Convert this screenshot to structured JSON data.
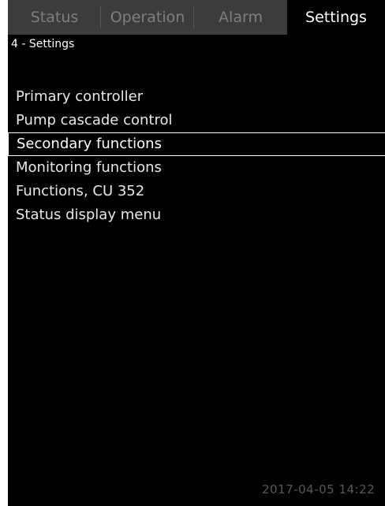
{
  "tabs": [
    {
      "label": "Status"
    },
    {
      "label": "Operation"
    },
    {
      "label": "Alarm"
    },
    {
      "label": "Settings"
    }
  ],
  "active_tab": "Settings",
  "breadcrumb": "4 - Settings",
  "menu": {
    "items": [
      {
        "label": "Primary controller"
      },
      {
        "label": "Pump cascade control"
      },
      {
        "label": "Secondary functions"
      },
      {
        "label": "Monitoring functions"
      },
      {
        "label": "Functions, CU 352"
      },
      {
        "label": "Status display menu"
      }
    ],
    "selected": "Secondary functions"
  },
  "footer": {
    "timestamp": "2017-04-05 14:22"
  }
}
